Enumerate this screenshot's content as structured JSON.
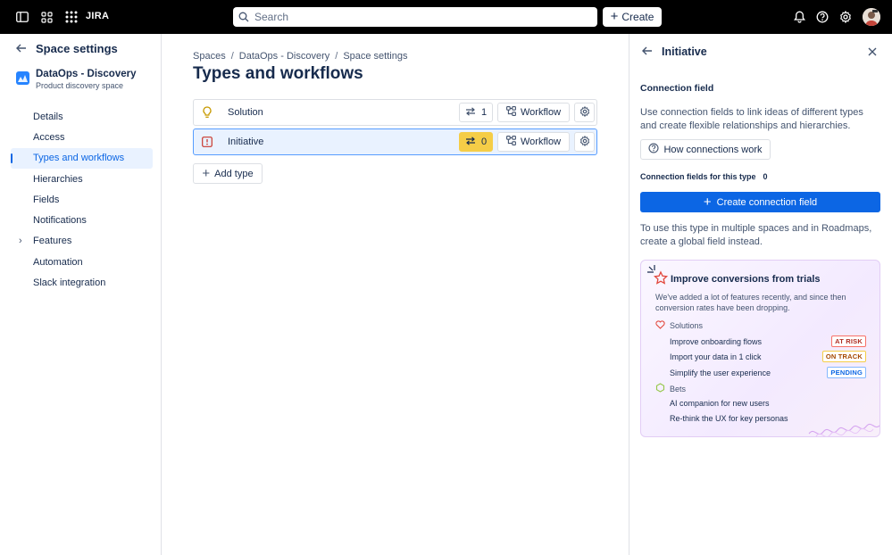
{
  "topbar": {
    "brand": "JIRA",
    "search_placeholder": "Search",
    "create_label": "Create"
  },
  "sidebar": {
    "title": "Space settings",
    "space_name": "DataOps - Discovery",
    "space_subtitle": "Product discovery space",
    "items": [
      {
        "label": "Details"
      },
      {
        "label": "Access"
      },
      {
        "label": "Types and workflows",
        "active": true
      },
      {
        "label": "Hierarchies"
      },
      {
        "label": "Fields"
      },
      {
        "label": "Notifications"
      },
      {
        "label": "Features",
        "expandable": true
      },
      {
        "label": "Automation"
      },
      {
        "label": "Slack integration"
      }
    ]
  },
  "main": {
    "breadcrumb": [
      "Spaces",
      "DataOps - Discovery",
      "Space settings"
    ],
    "breadcrumb_separator": "/",
    "title": "Types and workflows",
    "types": [
      {
        "name": "Solution",
        "icon": "lightbulb-icon",
        "count": "1",
        "workflow_label": "Workflow",
        "selected": false
      },
      {
        "name": "Initiative",
        "icon": "initiative-icon",
        "count": "0",
        "workflow_label": "Workflow",
        "selected": true
      }
    ],
    "add_type_label": "Add type"
  },
  "panel": {
    "title": "Initiative",
    "section_title": "Connection field",
    "description": "Use connection fields to link ideas of different types and create flexible relationships and hierarchies.",
    "how_label": "How connections work",
    "fields_label": "Connection fields for this type",
    "fields_count": "0",
    "create_label": "Create connection field",
    "hint": "To use this type in multiple spaces and in Roadmaps, create a global field instead.",
    "promo": {
      "title": "Improve conversions from trials",
      "description": "We've added a lot of features recently, and since then conversion rates have been dropping.",
      "group1": "Solutions",
      "items1": [
        {
          "label": "Improve onboarding flows",
          "status": "AT RISK"
        },
        {
          "label": "Import your data in 1 click",
          "status": "ON TRACK"
        },
        {
          "label": "Simplify the user experience",
          "status": "PENDING"
        }
      ],
      "group2": "Bets",
      "items2": [
        {
          "label": "AI companion for new users"
        },
        {
          "label": "Re-think the UX for key personas"
        }
      ]
    }
  },
  "colors": {
    "accent": "#0c66e4",
    "warning": "#f5cd47",
    "selected_bg": "#e9f2ff"
  }
}
